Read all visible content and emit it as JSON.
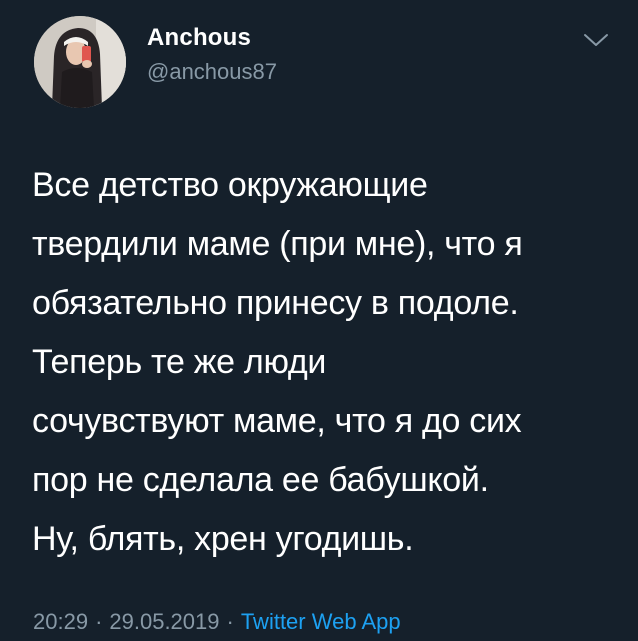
{
  "tweet": {
    "author": {
      "display_name": "Anchous",
      "handle": "@anchous87",
      "avatar_icon": "profile-photo"
    },
    "menu_icon": "chevron-down-icon",
    "text": "Все детство окружающие\nтвердили маме (при мне), что я\nобязательно принесу в подоле.\nТеперь те же люди\nсочувствуют маме, что я до сих\nпор не сделала ее бабушкой.\nНу, блять, хрен угодишь.",
    "time": "20:29",
    "separator": "·",
    "date": "29.05.2019",
    "source": "Twitter Web App"
  },
  "colors": {
    "background": "#15202b",
    "text": "#ffffff",
    "secondary": "#8899a6",
    "link": "#1da1f2"
  }
}
